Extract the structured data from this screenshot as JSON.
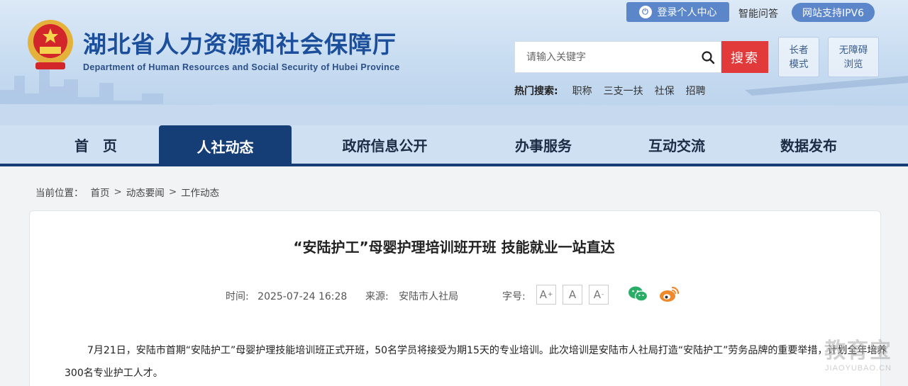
{
  "header": {
    "title": "湖北省人力资源和社会保障厅",
    "subtitle": "Department of Human Resources and Social Security of Hubei Province",
    "login_label": "登录个人中心",
    "qa_label": "智能问答",
    "ipv6_label": "网站支持IPV6",
    "search": {
      "placeholder": "请输入关键字",
      "button_label": "搜索"
    },
    "elder_mode": [
      "长者",
      "模式"
    ],
    "accessible_mode": [
      "无障碍",
      "浏览"
    ],
    "hot_search": {
      "label": "热门搜索:",
      "items": [
        "职称",
        "三支一扶",
        "社保",
        "招聘"
      ]
    }
  },
  "nav": {
    "items": [
      {
        "label": "首　页"
      },
      {
        "label": "人社动态"
      },
      {
        "label": "政府信息公开"
      },
      {
        "label": "办事服务"
      },
      {
        "label": "互动交流"
      },
      {
        "label": "数据发布"
      }
    ],
    "active_index": 1
  },
  "breadcrumb": {
    "label": "当前位置：",
    "items": [
      "首页",
      "动态要闻",
      "工作动态"
    ],
    "separator": ">"
  },
  "article": {
    "title": "“安陆护工”母婴护理培训班开班 技能就业一站直达",
    "time_label": "时间:",
    "time_value": "2025-07-24 16:28",
    "source_label": "来源:",
    "source_value": "安陆市人社局",
    "font_label": "字号:",
    "font_buttons": [
      "A",
      "A",
      "A"
    ],
    "body": [
      "7月21日，安陆市首期“安陆护工”母婴护理技能培训班正式开班，50名学员将接受为期15天的专业培训。此次培训是安陆市人社局打造“安陆护工”劳务品牌的重要举措，计划全年培养300名专业护工人才。"
    ]
  },
  "watermark": {
    "cn": "教育宝",
    "en": "JIAOYUBAO.CN"
  },
  "colors": {
    "primary": "#153e76",
    "title_blue": "#1b4f9b",
    "search_red": "#e23a3a",
    "badge_blue": "#5b86c9",
    "wechat_green": "#2aae67",
    "weibo_orange": "#f0892b"
  }
}
